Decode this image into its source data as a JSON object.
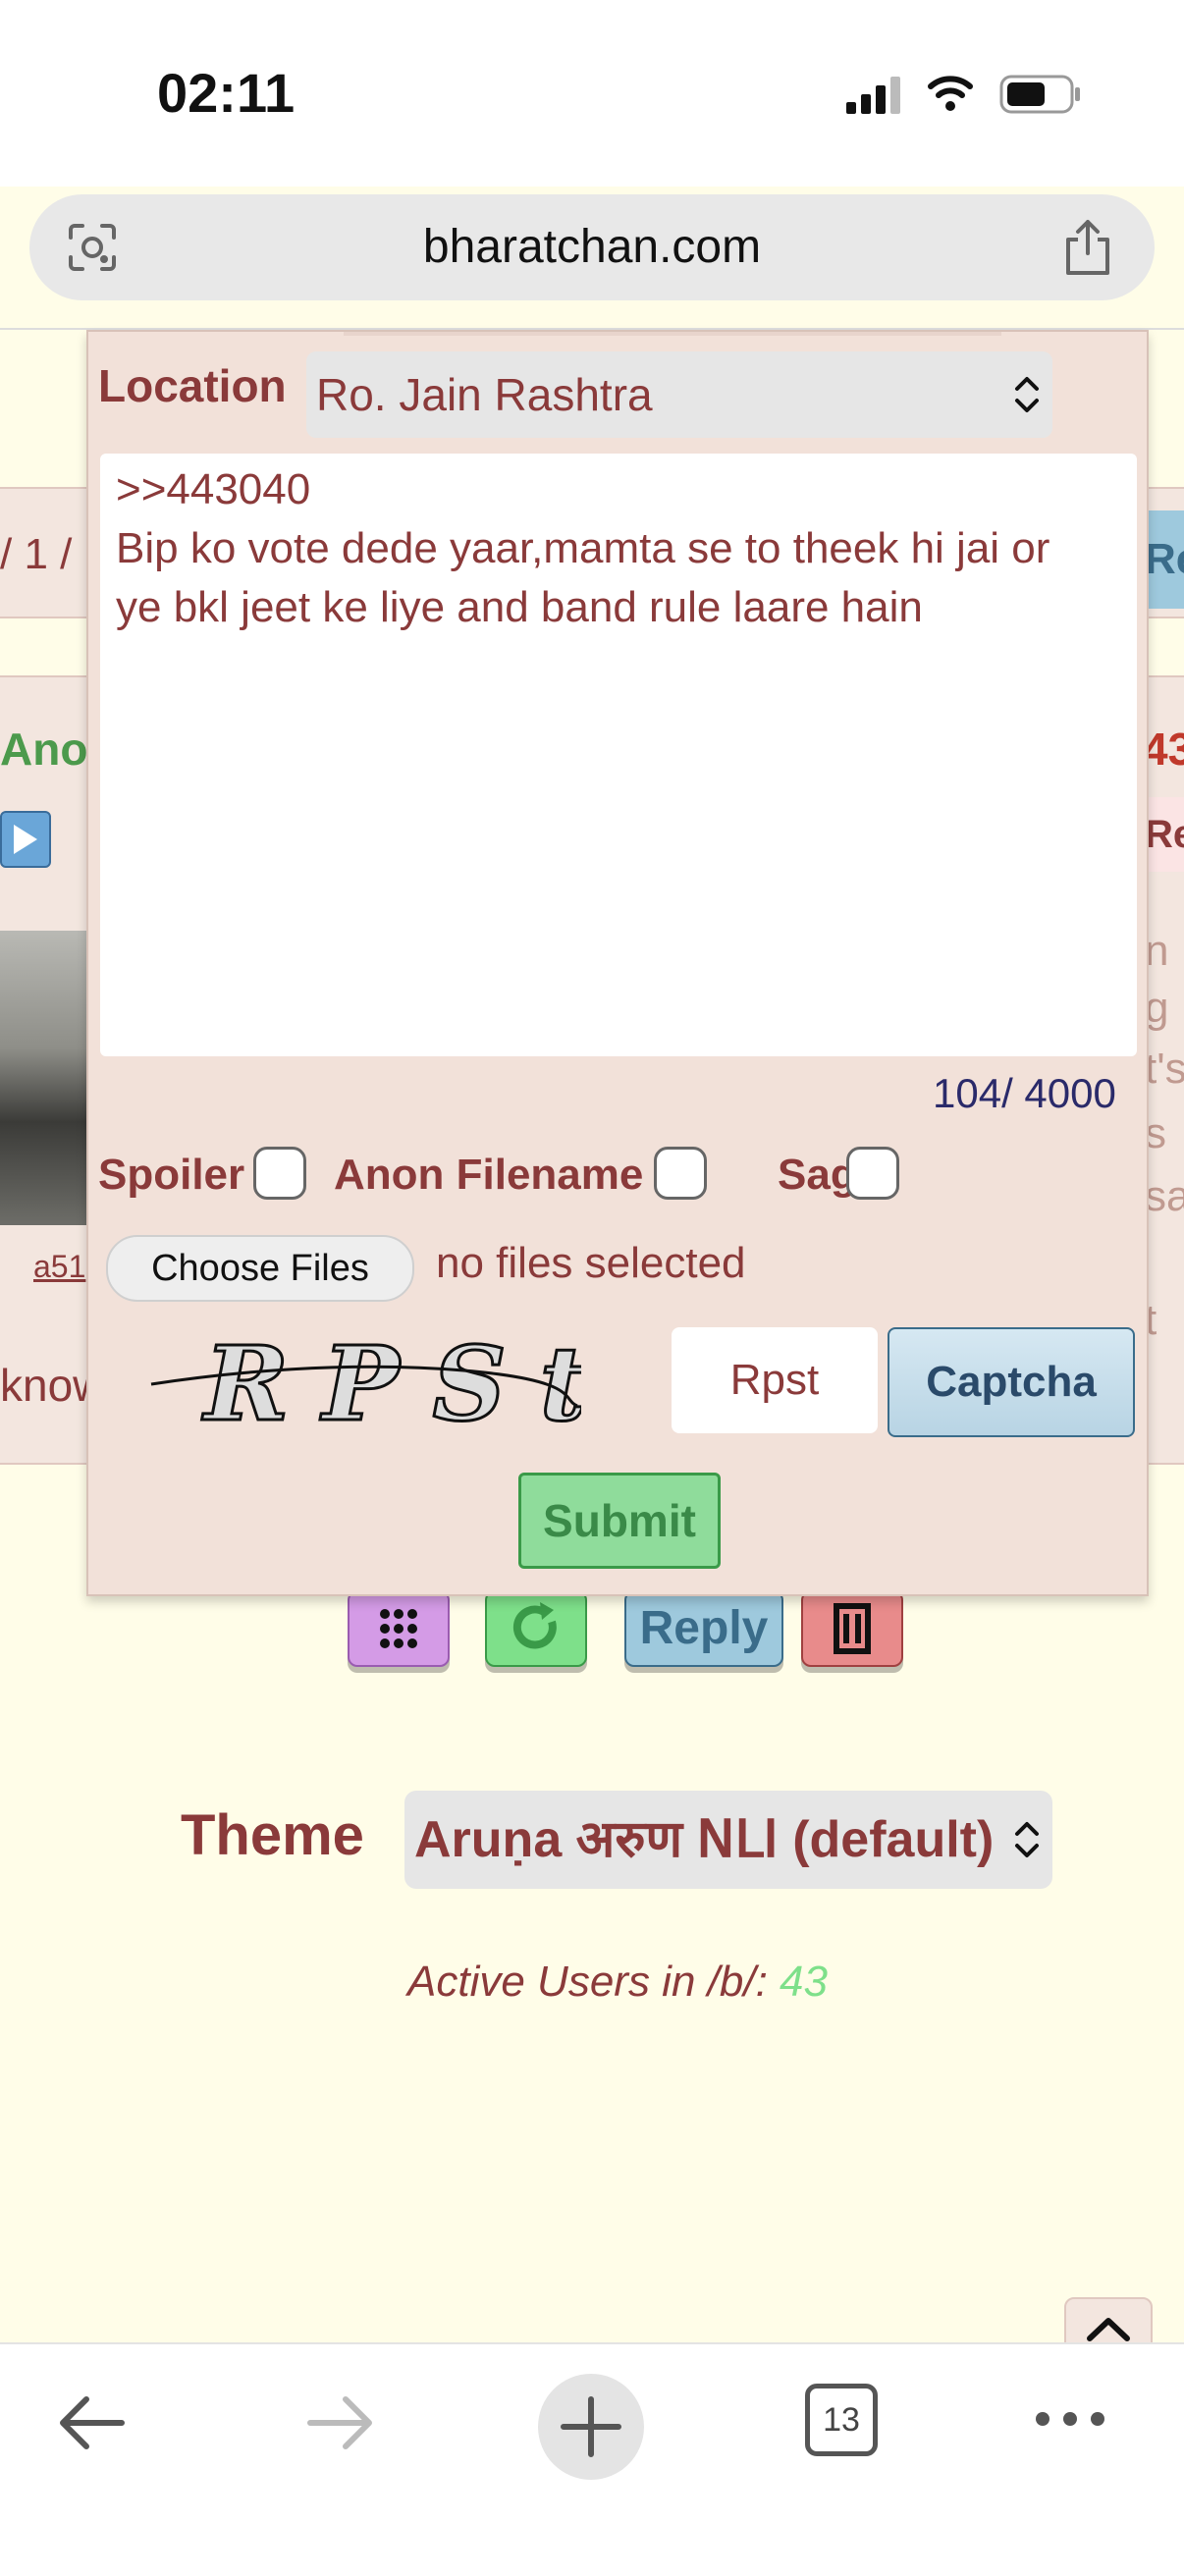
{
  "status_bar": {
    "time": "02:11"
  },
  "browser": {
    "url": "bharatchan.com",
    "tab_count": "13"
  },
  "background_page": {
    "pager_fragment": "/ 1 /",
    "reply_fragment": "Re",
    "poster_fragment": "Anon",
    "post_no_fragment": "43",
    "reply_fragment_2": "Re",
    "file_link_fragment": "a51",
    "body_fragment": "know",
    "side_text_fragments": [
      "n",
      "g",
      "t's",
      "s",
      "sa",
      "t"
    ]
  },
  "actions": {
    "reply_label": "Reply"
  },
  "footer": {
    "theme_label": "Theme",
    "theme_value": "Aruṇa अरुण ꓠꓡꓲ (default)",
    "active_users_label": "Active Users in /b/: ",
    "active_users_count": "43"
  },
  "reply_form": {
    "location_label": "Location",
    "location_value": "Ro. Jain Rashtra",
    "message_lines": [
      ">>443040",
      "Bip ko vote dede yaar,mamta se to theek hi jai or",
      "ye bkl jeet ke liye and band rule laare hain"
    ],
    "char_counter": "104/ 4000",
    "spoiler_label": "Spoiler",
    "anon_filename_label": "Anon Filename",
    "sage_label": "Sage",
    "choose_files_label": "Choose Files",
    "no_files_text": "no files selected",
    "captcha_text": "RPSt",
    "captcha_input_value": "Rpst",
    "captcha_button_label": "Captcha",
    "submit_label": "Submit"
  },
  "colors": {
    "page_bg": "#fffde8",
    "form_bg": "#f2e1d9",
    "label": "#8a3a3a",
    "active_count": "#7ee08a"
  }
}
